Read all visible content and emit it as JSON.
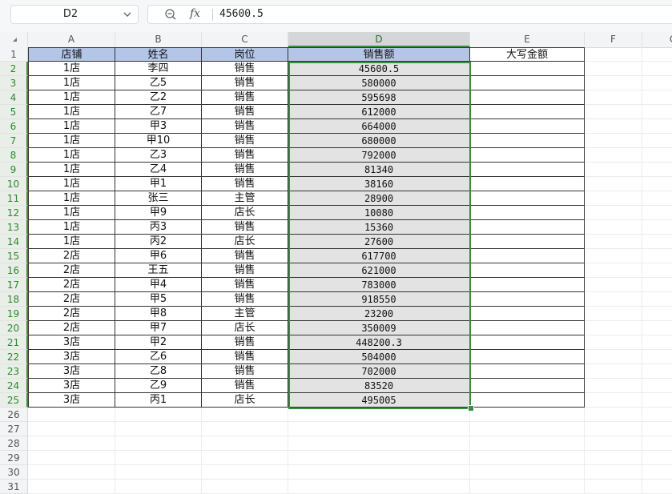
{
  "formula_bar": {
    "name_box": "D2",
    "fx_label": "fx",
    "formula": "45600.5"
  },
  "columns": [
    "A",
    "B",
    "C",
    "D",
    "E",
    "F",
    "G"
  ],
  "selected_column": "D",
  "headers": [
    "店铺",
    "姓名",
    "岗位",
    "销售额",
    "大写金额"
  ],
  "rows": [
    {
      "num": "2",
      "store": "1店",
      "name": "李四",
      "role": "销售",
      "sales": "45600.5"
    },
    {
      "num": "3",
      "store": "1店",
      "name": "乙5",
      "role": "销售",
      "sales": "580000"
    },
    {
      "num": "4",
      "store": "1店",
      "name": "乙2",
      "role": "销售",
      "sales": "595698"
    },
    {
      "num": "5",
      "store": "1店",
      "name": "乙7",
      "role": "销售",
      "sales": "612000"
    },
    {
      "num": "6",
      "store": "1店",
      "name": "甲3",
      "role": "销售",
      "sales": "664000"
    },
    {
      "num": "7",
      "store": "1店",
      "name": "甲10",
      "role": "销售",
      "sales": "680000"
    },
    {
      "num": "8",
      "store": "1店",
      "name": "乙3",
      "role": "销售",
      "sales": "792000"
    },
    {
      "num": "9",
      "store": "1店",
      "name": "乙4",
      "role": "销售",
      "sales": "81340"
    },
    {
      "num": "10",
      "store": "1店",
      "name": "甲1",
      "role": "销售",
      "sales": "38160"
    },
    {
      "num": "11",
      "store": "1店",
      "name": "张三",
      "role": "主管",
      "sales": "28900"
    },
    {
      "num": "12",
      "store": "1店",
      "name": "甲9",
      "role": "店长",
      "sales": "10080"
    },
    {
      "num": "13",
      "store": "1店",
      "name": "丙3",
      "role": "销售",
      "sales": "15360"
    },
    {
      "num": "14",
      "store": "1店",
      "name": "丙2",
      "role": "店长",
      "sales": "27600"
    },
    {
      "num": "15",
      "store": "2店",
      "name": "甲6",
      "role": "销售",
      "sales": "617700"
    },
    {
      "num": "16",
      "store": "2店",
      "name": "王五",
      "role": "销售",
      "sales": "621000"
    },
    {
      "num": "17",
      "store": "2店",
      "name": "甲4",
      "role": "销售",
      "sales": "783000"
    },
    {
      "num": "18",
      "store": "2店",
      "name": "甲5",
      "role": "销售",
      "sales": "918550"
    },
    {
      "num": "19",
      "store": "2店",
      "name": "甲8",
      "role": "主管",
      "sales": "23200"
    },
    {
      "num": "20",
      "store": "2店",
      "name": "甲7",
      "role": "店长",
      "sales": "350009"
    },
    {
      "num": "21",
      "store": "3店",
      "name": "甲2",
      "role": "销售",
      "sales": "448200.3"
    },
    {
      "num": "22",
      "store": "3店",
      "name": "乙6",
      "role": "销售",
      "sales": "504000"
    },
    {
      "num": "23",
      "store": "3店",
      "name": "乙8",
      "role": "销售",
      "sales": "702000"
    },
    {
      "num": "24",
      "store": "3店",
      "name": "乙9",
      "role": "销售",
      "sales": "83520"
    },
    {
      "num": "25",
      "store": "3店",
      "name": "丙1",
      "role": "店长",
      "sales": "495005"
    }
  ],
  "empty_rows": [
    "26",
    "27",
    "28",
    "29",
    "30",
    "31"
  ],
  "colors": {
    "header_fill": "#b4c6e7",
    "selection_fill": "#e3e3e3",
    "selection_border": "#3d8b3d"
  }
}
